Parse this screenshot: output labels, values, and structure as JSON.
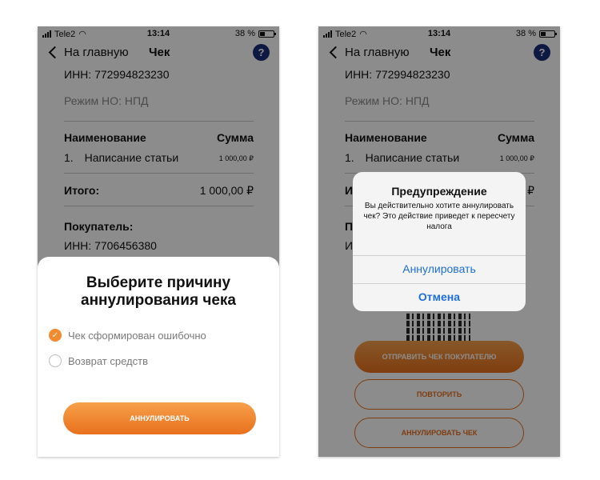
{
  "status_bar": {
    "carrier": "Tele2",
    "time": "13:14",
    "battery": "38 %"
  },
  "nav": {
    "back_label": "На главную",
    "title": "Чек",
    "help_label": "?"
  },
  "receipt": {
    "inn": "ИНН: 772994823230",
    "mode": "Режим НО: НПД",
    "header_name": "Наименование",
    "header_sum": "Сумма",
    "item_number": "1.",
    "item_name": "Написание статьи",
    "item_sum": "1 000,00 ₽",
    "total_label": "Итого:",
    "total_value": "1 000,00 ₽",
    "buyer_label": "Покупатель:",
    "buyer_inn": "ИНН: 7706456380"
  },
  "cancel_sheet": {
    "title": "Выберите причину аннулирования чека",
    "options": [
      {
        "label": "Чек сформирован ошибочно",
        "checked": true
      },
      {
        "label": "Возврат средств",
        "checked": false
      }
    ],
    "confirm_label": "АННУЛИРОВАТЬ"
  },
  "alert": {
    "title": "Предупреждение",
    "message": "Вы действительно хотите аннулировать чек? Это действие приведет к пересчету налога",
    "confirm_label": "Аннулировать",
    "cancel_label": "Отмена"
  },
  "actions": {
    "send_label": "ОТПРАВИТЬ ЧЕК ПОКУПАТЕЛЮ",
    "repeat_label": "ПОВТОРИТЬ",
    "annul_label": "АННУЛИРОВАТЬ ЧЕК"
  },
  "colors": {
    "accent": "#e8701d",
    "link": "#1f6fd6",
    "help": "#1a2e7a"
  }
}
